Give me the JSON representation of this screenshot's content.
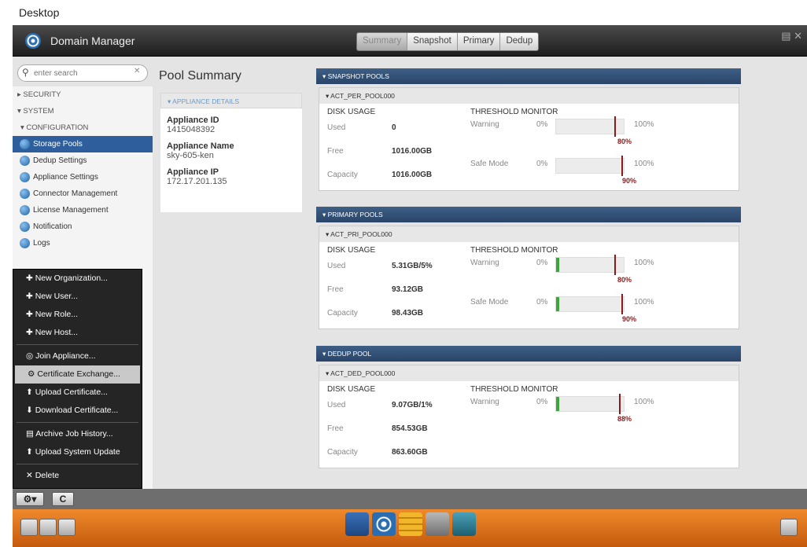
{
  "desktop": {
    "label": "Desktop"
  },
  "app": {
    "title": "Domain Manager"
  },
  "tabs": [
    "Summary",
    "Snapshot",
    "Primary",
    "Dedup"
  ],
  "search": {
    "placeholder": "enter search"
  },
  "sidebar": {
    "sections": [
      "SECURITY",
      "SYSTEM"
    ],
    "config": "CONFIGURATION",
    "items": [
      "Storage Pools",
      "Dedup Settings",
      "Appliance Settings",
      "Connector Management",
      "License Management",
      "Notification",
      "Logs"
    ]
  },
  "menu": {
    "items": [
      "New Organization...",
      "New User...",
      "New Role...",
      "New Host...",
      "Join Appliance...",
      "Certificate Exchange...",
      "Upload Certificate...",
      "Download Certificate...",
      "Archive Job History...",
      "Upload System Update",
      "Delete"
    ]
  },
  "bottom_bar": {
    "refresh_label": "C"
  },
  "main": {
    "title": "Pool Summary",
    "details": {
      "heading": "APPLIANCE DETAILS",
      "id_label": "Appliance ID",
      "id": "1415048392",
      "name_label": "Appliance Name",
      "name": "sky-605-ken",
      "ip_label": "Appliance IP",
      "ip": "172.17.201.135"
    },
    "labels": {
      "disk_usage": "DISK USAGE",
      "threshold": "THRESHOLD MONITOR",
      "used": "Used",
      "free": "Free",
      "capacity": "Capacity",
      "warning": "Warning",
      "safe_mode": "Safe Mode",
      "max": "100%"
    },
    "snapshot": {
      "heading": "SNAPSHOT POOLS",
      "pool": "ACT_PER_POOL000",
      "used": "0",
      "free": "1016.00GB",
      "capacity": "1016.00GB",
      "warn_pct": "0%",
      "warn_fill": 0,
      "warn_mark": "80%",
      "safe_pct": "0%",
      "safe_fill": 0,
      "safe_mark": "90%"
    },
    "primary": {
      "heading": "PRIMARY POOLS",
      "pool": "ACT_PRI_POOL000",
      "used": "5.31GB/5%",
      "free": "93.12GB",
      "capacity": "98.43GB",
      "warn_pct": "0%",
      "warn_fill": 0.05,
      "warn_mark": "80%",
      "safe_pct": "0%",
      "safe_fill": 0.05,
      "safe_mark": "90%"
    },
    "dedup": {
      "heading": "DEDUP POOL",
      "pool": "ACT_DED_POOL000",
      "used": "9.07GB/1%",
      "free": "854.53GB",
      "capacity": "863.60GB",
      "warn_pct": "0%",
      "warn_fill": 0.01,
      "warn_mark": "88%"
    }
  },
  "colors": {
    "accent": "#2e5f9c",
    "taskbar": "#e8761f",
    "marker": "#8b1a1a",
    "fill": "#3ca63c"
  },
  "icons": [
    "gear-icon",
    "refresh-icon",
    "help-icon",
    "settings-icon",
    "wrench-icon",
    "book-icon"
  ]
}
